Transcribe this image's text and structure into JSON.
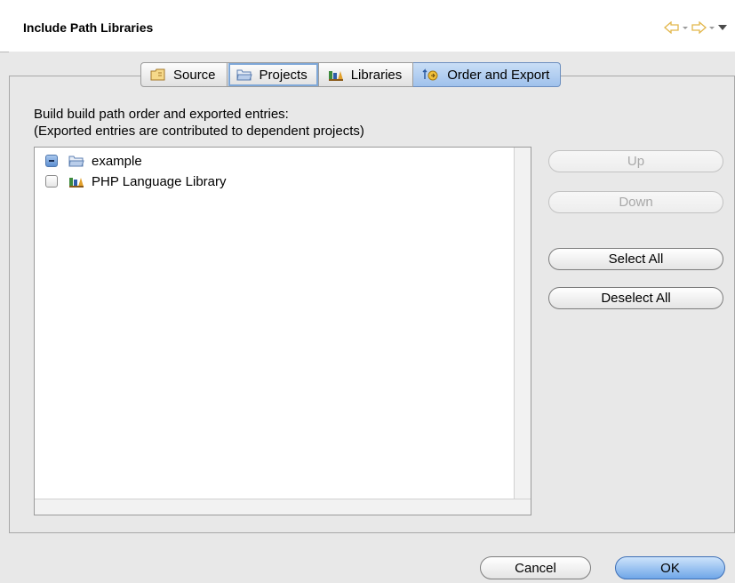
{
  "header": {
    "title": "Include Path Libraries",
    "icons": [
      "back-arrow-icon",
      "forward-arrow-icon",
      "view-menu-icon"
    ]
  },
  "tabs": [
    {
      "label": "Source",
      "icon": "source-folder-icon"
    },
    {
      "label": "Projects",
      "icon": "project-folder-icon"
    },
    {
      "label": "Libraries",
      "icon": "library-icon"
    },
    {
      "label": "Order and Export",
      "icon": "order-export-icon"
    }
  ],
  "selected_tab": "Order and Export",
  "description": {
    "line1": "Build build path order and exported entries:",
    "line2": "(Exported entries are contributed to dependent projects)"
  },
  "entries": [
    {
      "label": "example",
      "checked": "mixed",
      "icon": "project-folder-icon"
    },
    {
      "label": "PHP Language Library",
      "checked": false,
      "icon": "library-icon"
    }
  ],
  "side_buttons": {
    "up": "Up",
    "down": "Down",
    "select_all": "Select All",
    "deselect_all": "Deselect All"
  },
  "footer": {
    "cancel": "Cancel",
    "ok": "OK"
  },
  "colors": {
    "selected_tab": "#9fc1ec",
    "default_button": "#6fa6e8"
  }
}
